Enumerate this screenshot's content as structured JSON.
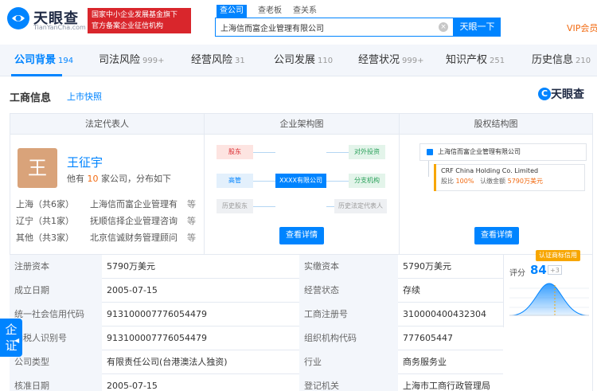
{
  "header": {
    "logo_cn": "天眼查",
    "logo_en": "TianYanCha.com",
    "banner_line1": "国家中小企业发展基金旗下",
    "banner_line2": "官方备案企业征信机构",
    "search_tabs": [
      "查公司",
      "查老板",
      "查关系"
    ],
    "search_value": "上海信而富企业管理有限公司",
    "search_button": "天眼一下",
    "vip": "VIP会员"
  },
  "nav": [
    {
      "label": "公司背景",
      "count": "194"
    },
    {
      "label": "司法风险",
      "count": "999+"
    },
    {
      "label": "经营风险",
      "count": "31"
    },
    {
      "label": "公司发展",
      "count": "110"
    },
    {
      "label": "经营状况",
      "count": "999+"
    },
    {
      "label": "知识产权",
      "count": "251"
    },
    {
      "label": "历史信息",
      "count": "210"
    }
  ],
  "section": {
    "title": "工商信息",
    "link": "上市快照",
    "brand": "天眼查"
  },
  "panels": {
    "legal_rep_title": "法定代表人",
    "org_title": "企业架构图",
    "equity_title": "股权结构图",
    "detail_button": "查看详情"
  },
  "legal_rep": {
    "avatar_char": "王",
    "name": "王征宇",
    "desc_prefix": "他有",
    "desc_count": "10",
    "desc_suffix": "家公司，分布如下",
    "regions": [
      {
        "region": "上海（共6家）",
        "company": "上海信而富企业管理有",
        "more": "等"
      },
      {
        "region": "辽宁（共1家）",
        "company": "抚顺信择企业管理咨询",
        "more": "等"
      },
      {
        "region": "其他（共3家）",
        "company": "北京信诚财务管理顾问",
        "more": "等"
      }
    ]
  },
  "org_chart": {
    "shareholder": "股东",
    "executive": "高管",
    "history_shareholder": "历史股东",
    "center": "XXXX有限公司",
    "investment": "对外投资",
    "branch": "分支机构",
    "history_legal": "历史法定代表人"
  },
  "equity": {
    "top": "上海信而富企业管理有限公司",
    "sub_name": "CRF China Holding Co. Limited",
    "ratio_label": "股比",
    "ratio_value": "100%",
    "amount_label": "认缴金额",
    "amount_value": "5790万美元"
  },
  "info_rows": [
    {
      "l1": "注册资本",
      "v1": "5790万美元",
      "l2": "实缴资本",
      "v2": "5790万美元"
    },
    {
      "l1": "成立日期",
      "v1": "2005-07-15",
      "l2": "经营状态",
      "v2": "存续"
    },
    {
      "l1": "统一社会信用代码",
      "v1": "913100007776054479",
      "l2": "工商注册号",
      "v2": "310000400432304"
    },
    {
      "l1": "纳税人识别号",
      "v1": "913100007776054479",
      "l2": "组织机构代码",
      "v2": "777605447"
    },
    {
      "l1": "公司类型",
      "v1": "有限责任公司(台港澳法人独资)",
      "l2": "行业",
      "v2": "商务服务业"
    },
    {
      "l1": "核准日期",
      "v1": "2005-07-15",
      "l2": "登记机关",
      "v2": "上海市工商行政管理局"
    }
  ],
  "score": {
    "tag": "认证商标信用",
    "label": "评分",
    "value": "84",
    "delta": "+3",
    "accent": "#0084ff"
  },
  "float_tag": {
    "line1": "企",
    "line2": "证"
  },
  "colors": {
    "brand_blue": "#0084ff",
    "banner_red": "#d9262c",
    "orange": "#f26a11",
    "avatar": "#d9a37a"
  }
}
